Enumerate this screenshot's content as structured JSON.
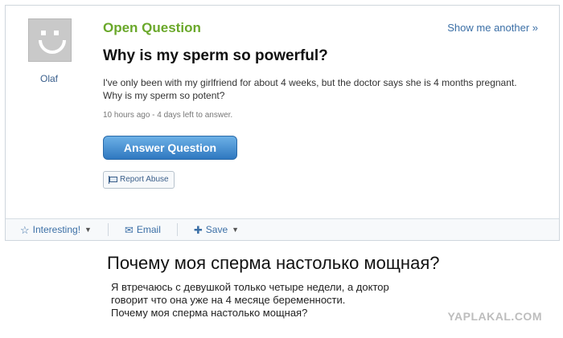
{
  "user": {
    "name": "Olaf"
  },
  "header": {
    "badge": "Open Question",
    "show_another": "Show me another »"
  },
  "question": {
    "title": "Why is my sperm so powerful?",
    "body": "I've only been with my girlfriend for about 4 weeks, but the doctor says she is 4 months pregnant. Why is my sperm so potent?",
    "meta": "10 hours ago - 4 days left to answer."
  },
  "buttons": {
    "answer": "Answer Question",
    "report": "Report Abuse"
  },
  "toolbar": {
    "interesting": "Interesting!",
    "email": "Email",
    "save": "Save"
  },
  "translation": {
    "title": "Почему моя сперма настолько мощная?",
    "lines": [
      "Я втречаюсь с девушкой только четыре недели, а доктор",
      "говорит что она уже на 4 месяце беременности.",
      "Почему моя сперма настолько мощная?"
    ]
  },
  "watermark": "YAPLAKAL.COM",
  "colors": {
    "accent_green": "#6aa82a",
    "link_blue": "#3b6fa6",
    "button_blue": "#2f78c0"
  }
}
